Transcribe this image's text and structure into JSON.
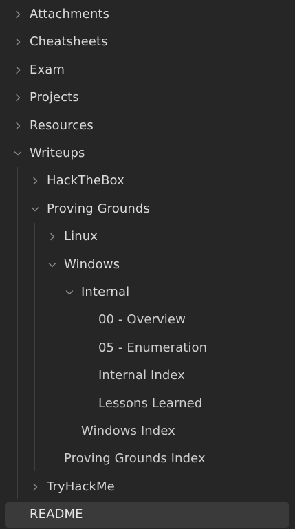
{
  "explorer": {
    "items": [
      {
        "label": "Attachments",
        "type": "folder",
        "state": "collapsed"
      },
      {
        "label": "Cheatsheets",
        "type": "folder",
        "state": "collapsed"
      },
      {
        "label": "Exam",
        "type": "folder",
        "state": "collapsed"
      },
      {
        "label": "Projects",
        "type": "folder",
        "state": "collapsed"
      },
      {
        "label": "Resources",
        "type": "folder",
        "state": "collapsed"
      },
      {
        "label": "Writeups",
        "type": "folder",
        "state": "expanded"
      },
      {
        "label": "HackTheBox",
        "type": "folder",
        "state": "collapsed"
      },
      {
        "label": "Proving Grounds",
        "type": "folder",
        "state": "expanded"
      },
      {
        "label": "Linux",
        "type": "folder",
        "state": "collapsed"
      },
      {
        "label": "Windows",
        "type": "folder",
        "state": "expanded"
      },
      {
        "label": "Internal",
        "type": "folder",
        "state": "expanded"
      },
      {
        "label": "00 - Overview",
        "type": "file"
      },
      {
        "label": "05 - Enumeration",
        "type": "file"
      },
      {
        "label": "Internal Index",
        "type": "file"
      },
      {
        "label": "Lessons Learned",
        "type": "file"
      },
      {
        "label": "Windows Index",
        "type": "file"
      },
      {
        "label": "Proving Grounds Index",
        "type": "file"
      },
      {
        "label": "TryHackMe",
        "type": "folder",
        "state": "collapsed"
      },
      {
        "label": "README",
        "type": "file",
        "selected": true
      }
    ]
  },
  "colors": {
    "background": "#262626",
    "selected_row": "#3a3a3a",
    "text": "#dcdcdc",
    "chevron": "#8a8a8a",
    "indent_guide": "#3f3f3f"
  },
  "icons": {
    "collapsed": "chevron-right-icon",
    "expanded": "chevron-down-icon"
  }
}
